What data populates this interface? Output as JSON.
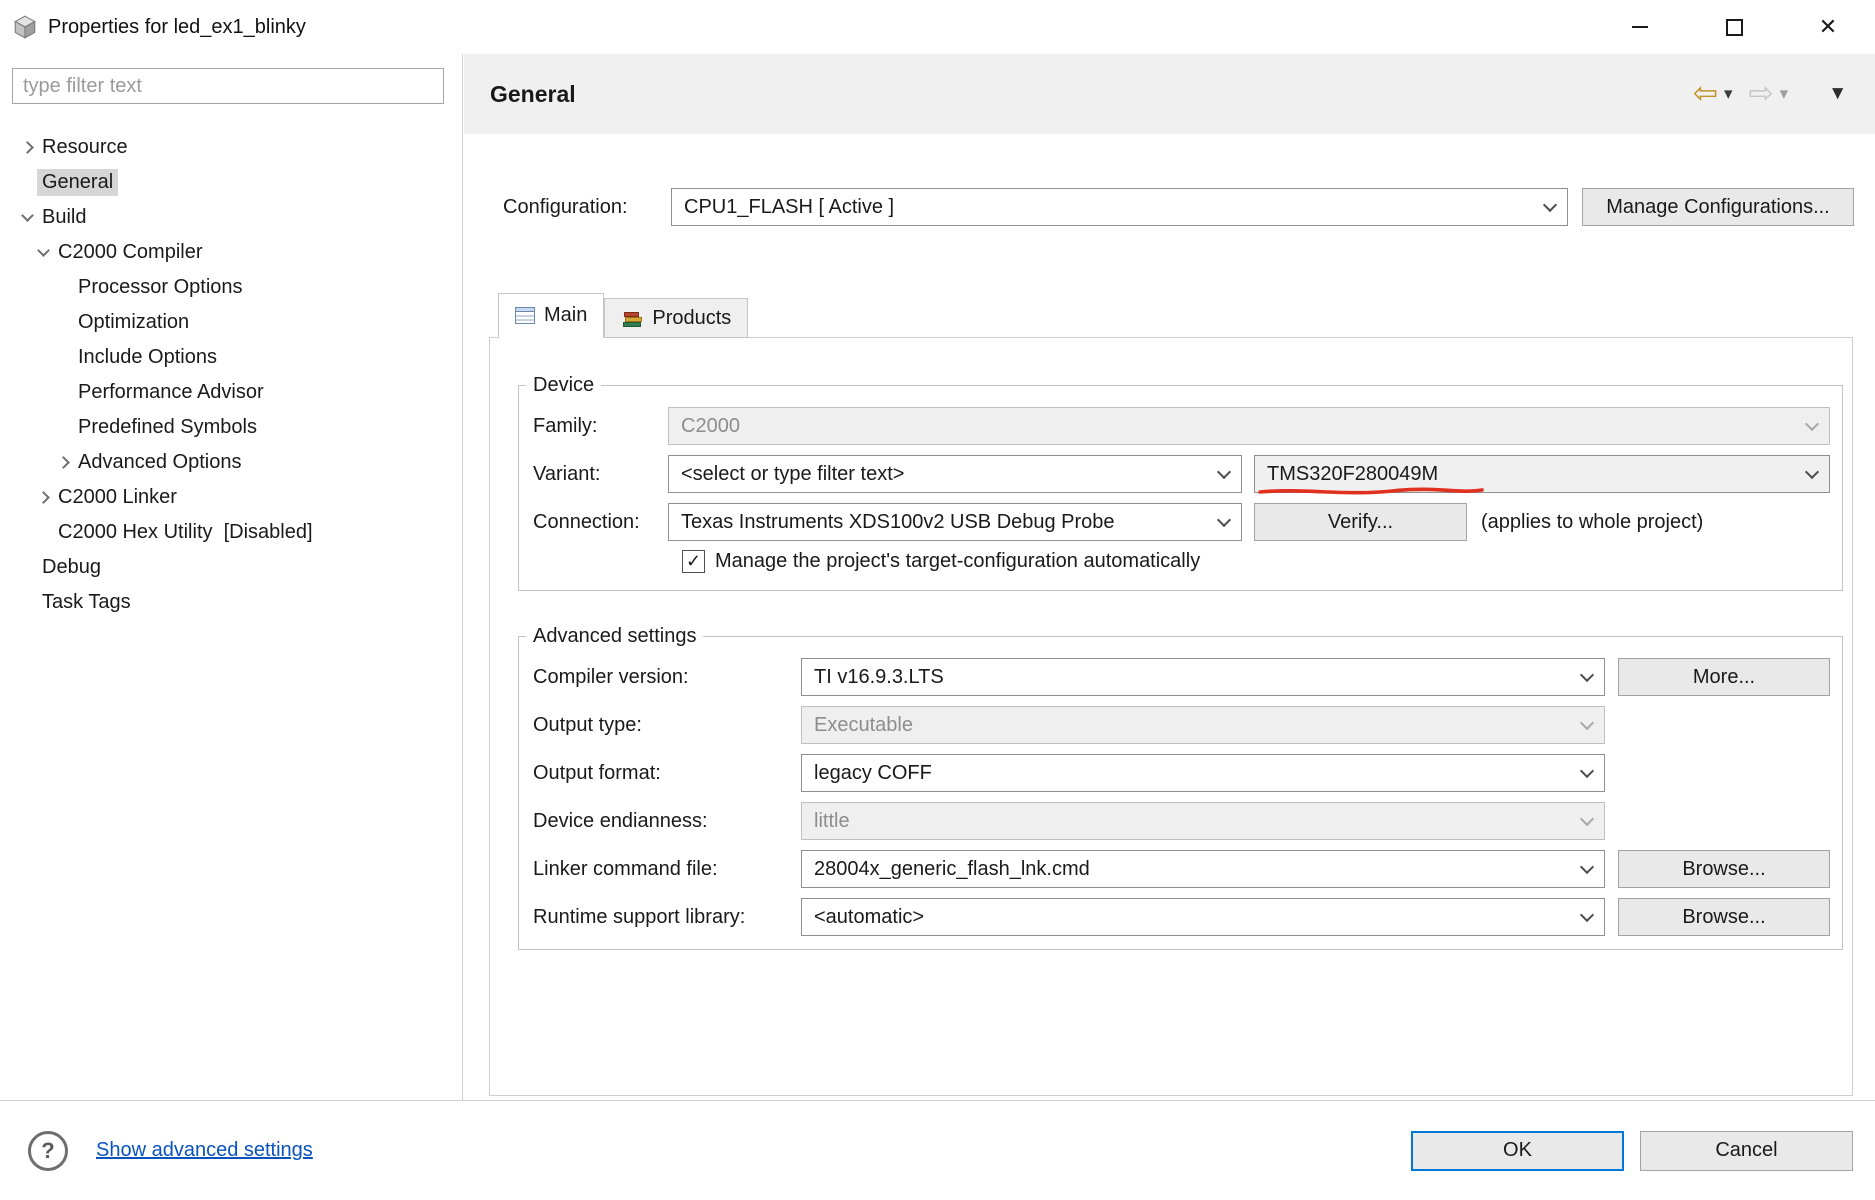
{
  "colors": {
    "accent_blue": "#0078d7",
    "annotation_red": "#e0301e",
    "link_blue": "#0a53be",
    "selection_gray": "#d6d6d6",
    "header_gray": "#f0f0f0"
  },
  "window": {
    "title": "Properties for led_ex1_blinky"
  },
  "icons": {
    "close": "✕",
    "nav_back": "⇦",
    "nav_forward": "⇨",
    "caret_down": "▾",
    "menu_down": "▼",
    "help": "?",
    "checkmark": "✓"
  },
  "sidebar": {
    "filter_placeholder": "type filter text",
    "tree": [
      {
        "label": "Resource"
      },
      {
        "label": "General"
      },
      {
        "label": "Build"
      },
      {
        "label": "C2000 Compiler"
      },
      {
        "label": "Processor Options"
      },
      {
        "label": "Optimization"
      },
      {
        "label": "Include Options"
      },
      {
        "label": "Performance Advisor"
      },
      {
        "label": "Predefined Symbols"
      },
      {
        "label": "Advanced Options"
      },
      {
        "label": "C2000 Linker"
      },
      {
        "label": "C2000 Hex Utility  [Disabled]"
      },
      {
        "label": "Debug"
      },
      {
        "label": "Task Tags"
      }
    ]
  },
  "header": {
    "title": "General"
  },
  "configuration": {
    "label": "Configuration:",
    "value": "CPU1_FLASH  [ Active ]",
    "manage_button": "Manage Configurations..."
  },
  "tabs": {
    "main": "Main",
    "products": "Products"
  },
  "device": {
    "legend": "Device",
    "family_label": "Family:",
    "family_value": "C2000",
    "variant_label": "Variant:",
    "variant_filter": "<select or type filter text>",
    "variant_value": "TMS320F280049M",
    "connection_label": "Connection:",
    "connection_value": "Texas Instruments XDS100v2 USB Debug Probe",
    "verify_button": "Verify...",
    "connection_note": "(applies to whole project)",
    "auto_manage_label": "Manage the project's target-configuration automatically",
    "auto_manage_checked": true
  },
  "advanced": {
    "legend": "Advanced settings",
    "rows": [
      {
        "label": "Compiler version:",
        "value": "TI v16.9.3.LTS",
        "button": "More...",
        "disabled": false
      },
      {
        "label": "Output type:",
        "value": "Executable",
        "disabled": true
      },
      {
        "label": "Output format:",
        "value": "legacy COFF",
        "disabled": false
      },
      {
        "label": "Device endianness:",
        "value": "little",
        "disabled": true
      },
      {
        "label": "Linker command file:",
        "value": "28004x_generic_flash_lnk.cmd",
        "button": "Browse...",
        "disabled": false
      },
      {
        "label": "Runtime support library:",
        "value": "<automatic>",
        "button": "Browse...",
        "disabled": false
      }
    ]
  },
  "footer": {
    "link": "Show advanced settings",
    "ok": "OK",
    "cancel": "Cancel"
  }
}
